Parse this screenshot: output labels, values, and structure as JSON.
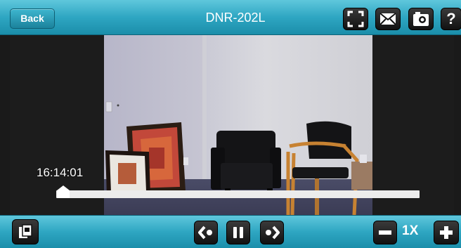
{
  "header": {
    "back_label": "Back",
    "title": "DNR-202L",
    "icons": [
      "fullscreen-icon",
      "email-icon",
      "snapshot-icon",
      "help-icon"
    ],
    "help_glyph": "?"
  },
  "player": {
    "timestamp": "16:14:01",
    "seek_progress": 0.02
  },
  "footer": {
    "icons": [
      "file-browser-icon",
      "rewind-icon",
      "pause-icon",
      "forward-icon",
      "speed-down-icon",
      "speed-up-icon"
    ],
    "speed_label": "1X"
  },
  "colors": {
    "bar_top": "#5fc7dc",
    "bar_bottom": "#1b8eaa",
    "button_dark": "#111111",
    "track": "#ececec"
  }
}
